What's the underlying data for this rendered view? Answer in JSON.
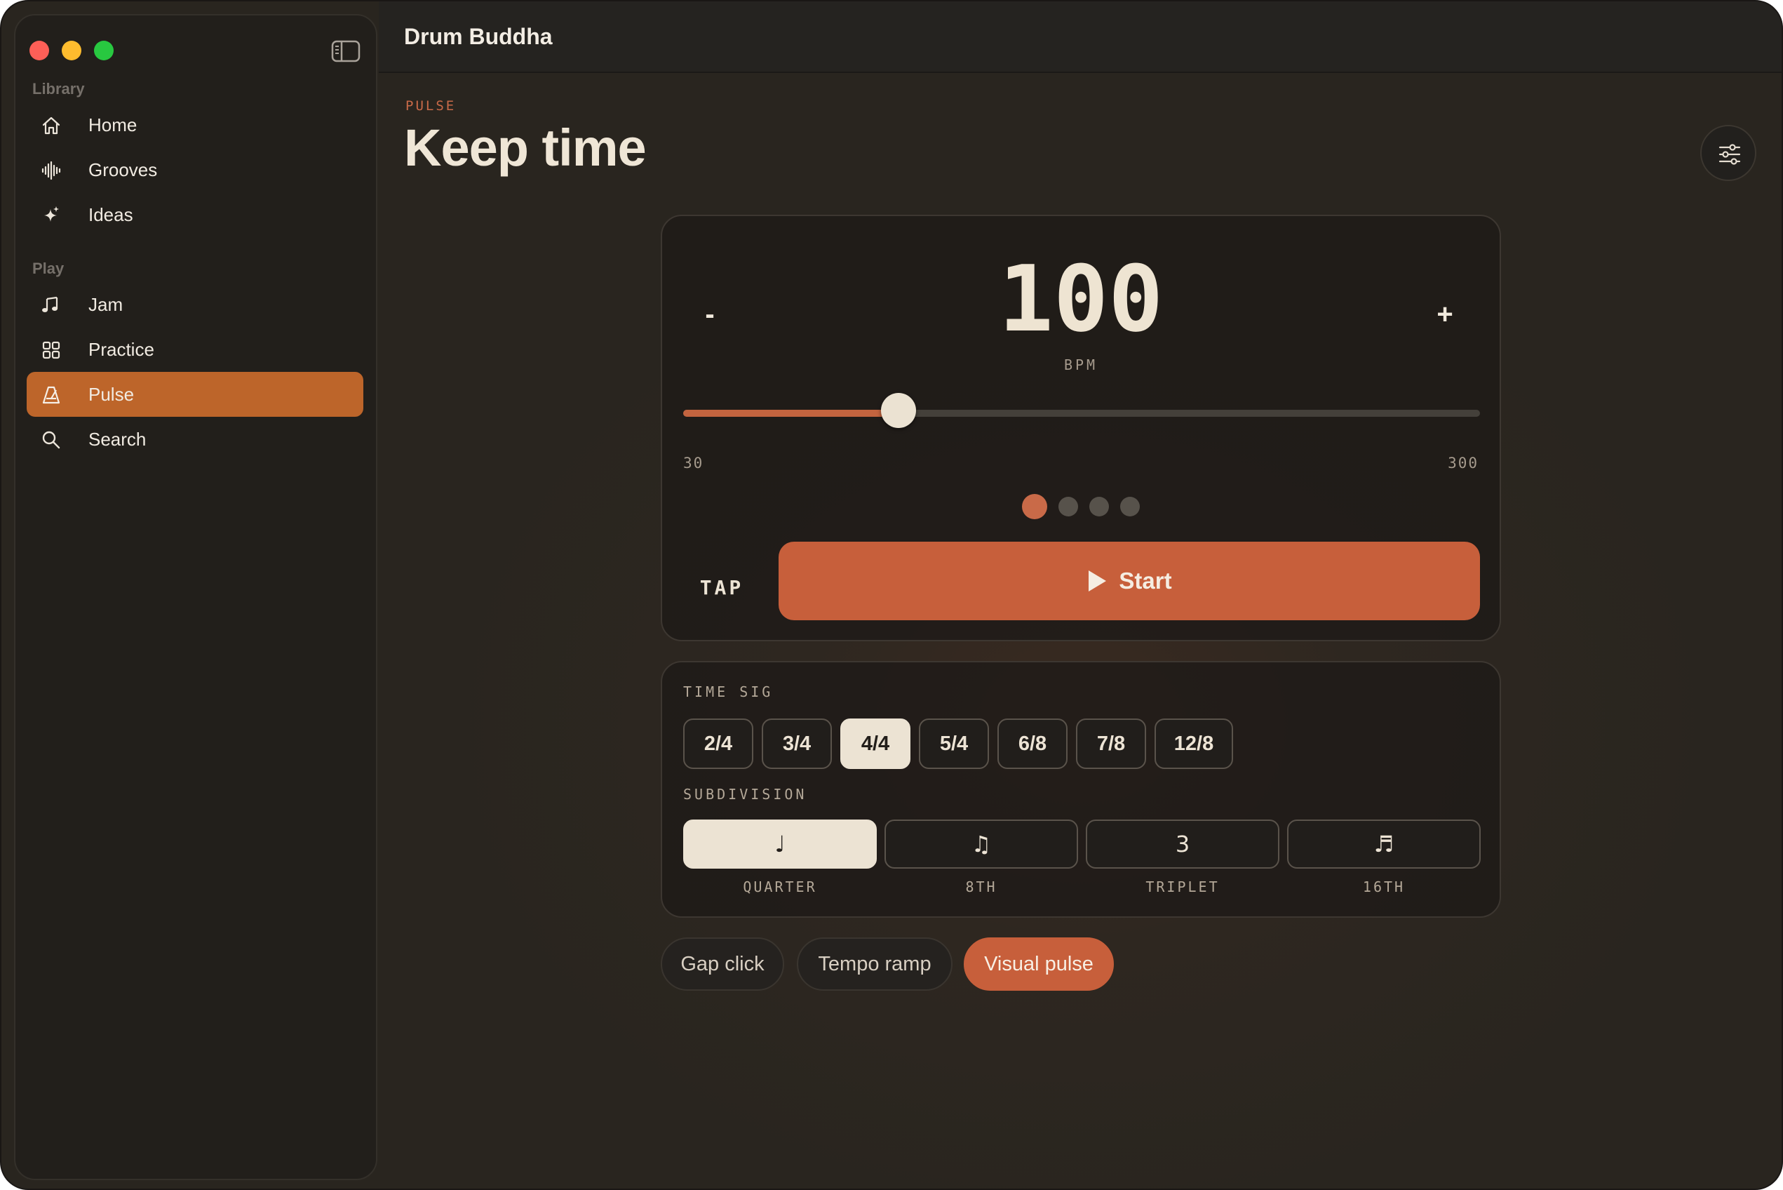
{
  "app": {
    "title": "Drum Buddha"
  },
  "sidebar": {
    "sections": [
      {
        "label": "Library",
        "items": [
          {
            "label": "Home",
            "icon": "home-icon"
          },
          {
            "label": "Grooves",
            "icon": "waveform-icon"
          },
          {
            "label": "Ideas",
            "icon": "sparkle-icon"
          }
        ]
      },
      {
        "label": "Play",
        "items": [
          {
            "label": "Jam",
            "icon": "music-notes-icon"
          },
          {
            "label": "Practice",
            "icon": "grid-icon"
          },
          {
            "label": "Pulse",
            "icon": "metronome-icon",
            "active": true
          },
          {
            "label": "Search",
            "icon": "search-icon"
          }
        ]
      }
    ]
  },
  "header": {
    "eyebrow": "PULSE",
    "title": "Keep time"
  },
  "metronome": {
    "decrement_label": "-",
    "increment_label": "+",
    "bpm": "100",
    "bpm_unit": "BPM",
    "range_min": "30",
    "range_max": "300",
    "slider_fraction": 0.27,
    "beats": 4,
    "current_beat": 1,
    "tap_label": "TAP",
    "start_label": "Start"
  },
  "time_sig": {
    "label": "TIME SIG",
    "options": [
      "2/4",
      "3/4",
      "4/4",
      "5/4",
      "6/8",
      "7/8",
      "12/8"
    ],
    "selected": "4/4"
  },
  "subdivision": {
    "label": "SUBDIVISION",
    "options": [
      {
        "glyph": "♩",
        "label": "QUARTER",
        "active": true
      },
      {
        "glyph": "♫",
        "label": "8TH"
      },
      {
        "glyph": "3",
        "label": "TRIPLET"
      },
      {
        "glyph": "♬",
        "label": "16TH"
      }
    ]
  },
  "modes": [
    {
      "label": "Gap click"
    },
    {
      "label": "Tempo ramp"
    },
    {
      "label": "Visual pulse",
      "active": true
    }
  ],
  "colors": {
    "accent": "#c75f3b",
    "sidebar_active": "#bd652a",
    "cream": "#ece3d3"
  }
}
